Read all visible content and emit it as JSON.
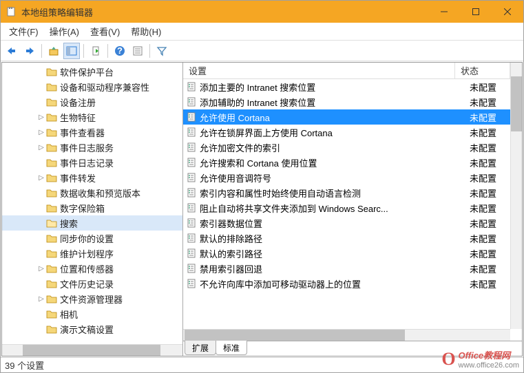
{
  "window": {
    "title": "本地组策略编辑器"
  },
  "menu": [
    "文件(F)",
    "操作(A)",
    "查看(V)",
    "帮助(H)"
  ],
  "tree": [
    {
      "label": "软件保护平台",
      "exp": ""
    },
    {
      "label": "设备和驱动程序兼容性",
      "exp": ""
    },
    {
      "label": "设备注册",
      "exp": ""
    },
    {
      "label": "生物特征",
      "exp": ">"
    },
    {
      "label": "事件查看器",
      "exp": ">"
    },
    {
      "label": "事件日志服务",
      "exp": ">"
    },
    {
      "label": "事件日志记录",
      "exp": ""
    },
    {
      "label": "事件转发",
      "exp": ">"
    },
    {
      "label": "数据收集和预览版本",
      "exp": ""
    },
    {
      "label": "数字保险箱",
      "exp": ""
    },
    {
      "label": "搜索",
      "exp": "",
      "sel": true
    },
    {
      "label": "同步你的设置",
      "exp": ""
    },
    {
      "label": "维护计划程序",
      "exp": ""
    },
    {
      "label": "位置和传感器",
      "exp": ">"
    },
    {
      "label": "文件历史记录",
      "exp": ""
    },
    {
      "label": "文件资源管理器",
      "exp": ">"
    },
    {
      "label": "相机",
      "exp": ""
    },
    {
      "label": "演示文稿设置",
      "exp": ""
    }
  ],
  "columns": {
    "setting": "设置",
    "state": "状态"
  },
  "rows": [
    {
      "label": "添加主要的 Intranet 搜索位置",
      "state": "未配置"
    },
    {
      "label": "添加辅助的 Intranet 搜索位置",
      "state": "未配置"
    },
    {
      "label": "允许使用 Cortana",
      "state": "未配置",
      "sel": true
    },
    {
      "label": "允许在锁屏界面上方使用 Cortana",
      "state": "未配置"
    },
    {
      "label": "允许加密文件的索引",
      "state": "未配置"
    },
    {
      "label": "允许搜索和 Cortana 使用位置",
      "state": "未配置"
    },
    {
      "label": "允许使用音调符号",
      "state": "未配置"
    },
    {
      "label": "索引内容和属性时始终使用自动语言检测",
      "state": "未配置"
    },
    {
      "label": "阻止自动将共享文件夹添加到 Windows Searc...",
      "state": "未配置"
    },
    {
      "label": "索引器数据位置",
      "state": "未配置"
    },
    {
      "label": "默认的排除路径",
      "state": "未配置"
    },
    {
      "label": "默认的索引路径",
      "state": "未配置"
    },
    {
      "label": "禁用索引器回退",
      "state": "未配置"
    },
    {
      "label": "不允许向库中添加可移动驱动器上的位置",
      "state": "未配置"
    }
  ],
  "tabs": {
    "extended": "扩展",
    "standard": "标准"
  },
  "status": "39 个设置",
  "watermark": {
    "brand": "Office教程网",
    "url": "www.office26.com"
  }
}
